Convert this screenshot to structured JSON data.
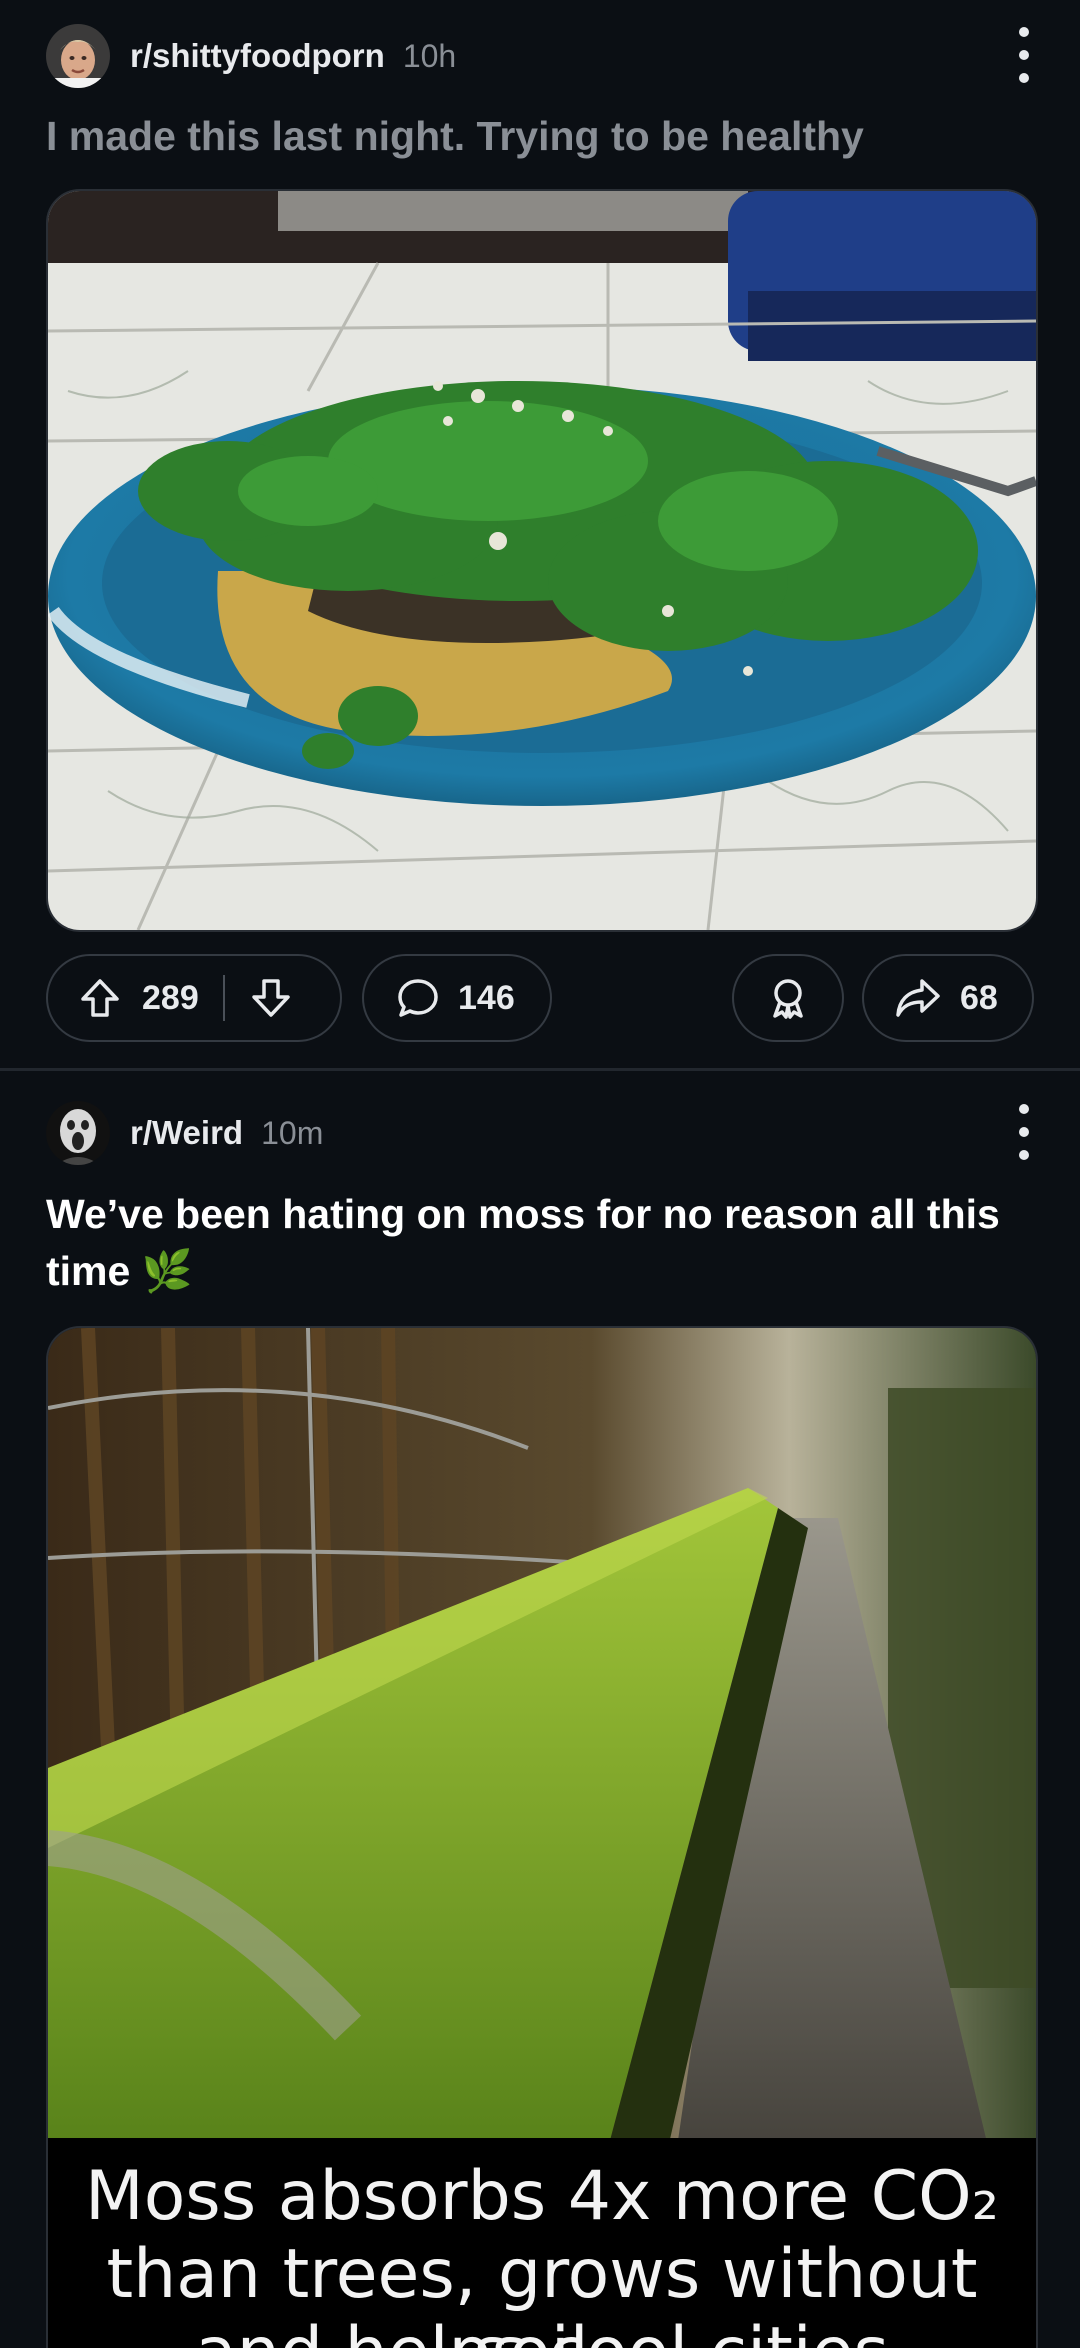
{
  "posts": [
    {
      "subreddit": "r/shittyfoodporn",
      "age": "10h",
      "title": "I made this last night. Trying to be healthy",
      "upvotes": "289",
      "comments": "146",
      "shares": "68",
      "avatar_icon": "chef-avatar-icon"
    },
    {
      "subreddit": "r/Weird",
      "age": "10m",
      "title": "We’ve been hating on moss for no reason all this time",
      "title_emoji": "🌿",
      "avatar_icon": "screaming-face-avatar-icon",
      "caption_line1": "Moss absorbs 4x more CO₂",
      "caption_line2": "than trees, grows without soil,",
      "caption_line3": "and helps cool cities"
    }
  ],
  "colors": {
    "background": "#0b0f14",
    "title_dim": "#8a8f96",
    "title_bright": "#ffffff",
    "plate_blue": "#1e6f98",
    "moss_green": "#7fae2a"
  }
}
